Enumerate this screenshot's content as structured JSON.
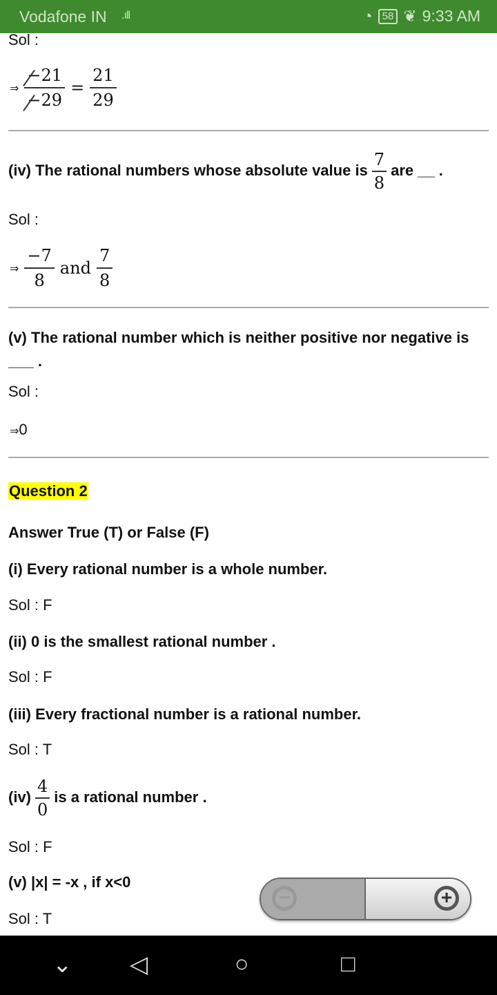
{
  "status": {
    "carrier": "Vodafone IN",
    "signal": ".ıll",
    "time": "9:33 AM",
    "battery": "58",
    "colors": {
      "bar": "#3f8a2f"
    }
  },
  "content": {
    "sol": "Sol :",
    "frac1": {
      "n": "21",
      "d": "29",
      "eq": "=",
      "rn": "21",
      "rd": "29",
      "neg": "−"
    },
    "q_iv": {
      "before": "(iv) The rational numbers whose absolute value is",
      "n": "7",
      "d": "8",
      "after": "are __ ."
    },
    "sol_iv": {
      "n1": "−7",
      "d1": "8",
      "and": "and",
      "n2": "7",
      "d2": "8"
    },
    "q_v": {
      "text": "(v) The rational number which is neither positive nor negative is",
      "blank": "___ ."
    },
    "sol_v": "0",
    "q2_title": "Question 2",
    "instruction": "Answer True (T) or False (F)",
    "items": [
      {
        "q": "(i) Every rational number is a whole number.",
        "sol": "Sol : F"
      },
      {
        "q": "(ii) 0 is the smallest rational number .",
        "sol": "Sol : F"
      },
      {
        "q": "(iii) Every fractional number is a rational number.",
        "sol": "Sol : T"
      },
      {
        "q_pre": "(iv)",
        "n": "4",
        "d": "0",
        "q_post": "is a rational number .",
        "sol": "Sol : F"
      },
      {
        "q": "(v) |x| = -x , if x<0",
        "sol": "Sol : T"
      }
    ],
    "arrow": "⇒"
  },
  "zoom": {
    "out": "−",
    "in": "+"
  },
  "nav": {
    "down": "⌄",
    "back": "◁",
    "home": "○",
    "recent": "□"
  }
}
